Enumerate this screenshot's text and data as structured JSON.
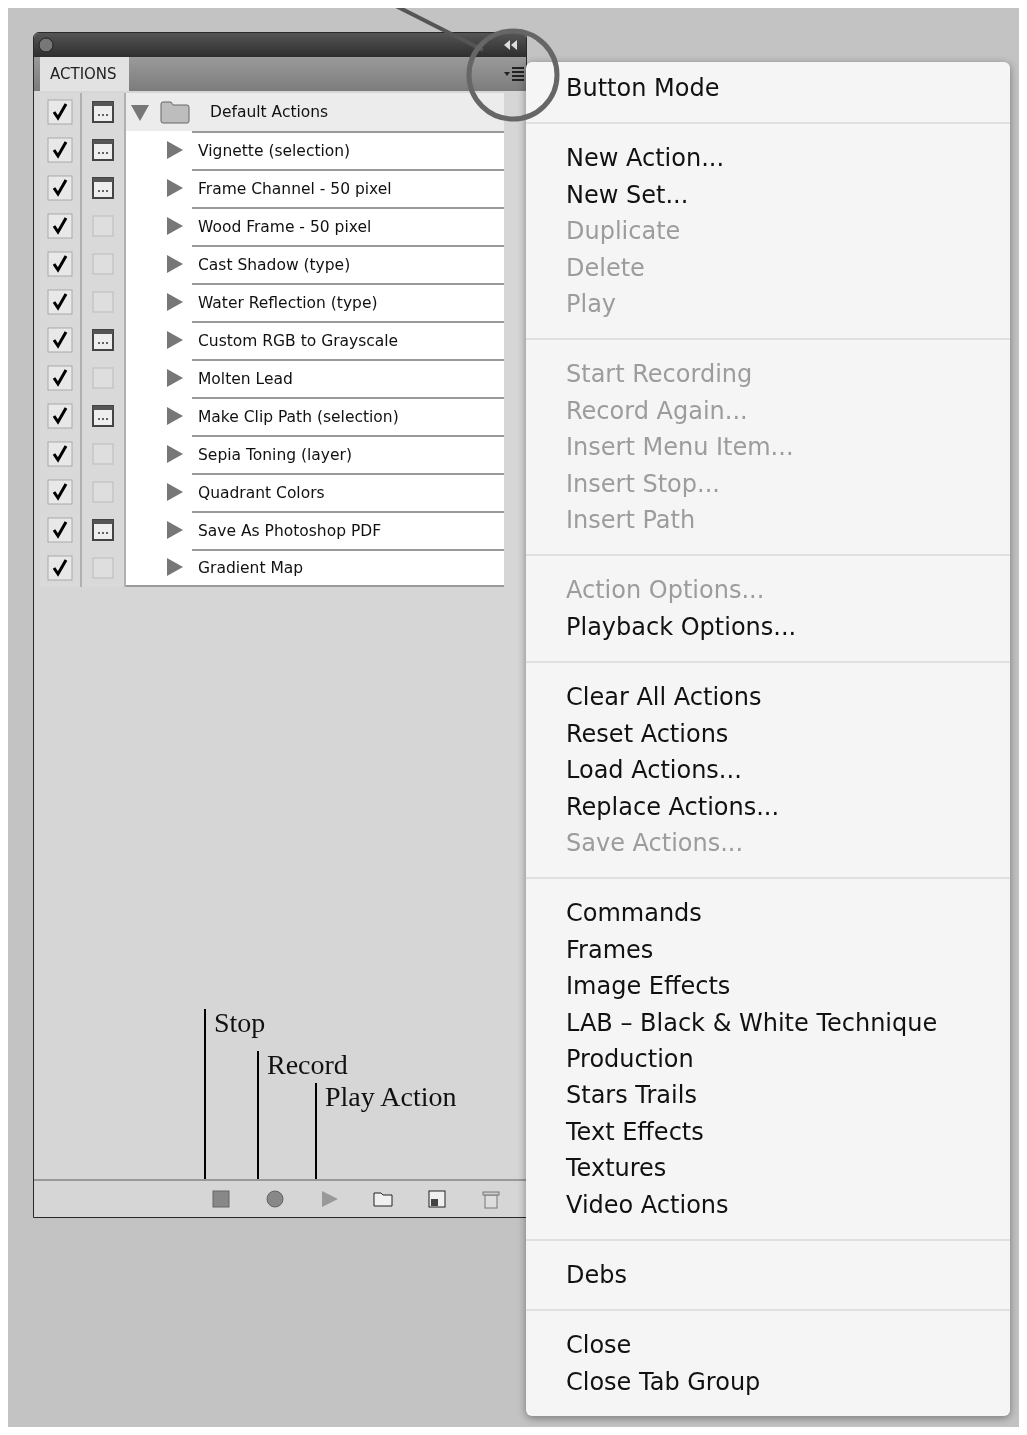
{
  "panel": {
    "tab": "ACTIONS",
    "sets": [
      {
        "name": "Default Actions",
        "expanded": true,
        "enabled": true,
        "dialog": true,
        "actions": [
          {
            "name": "Vignette (selection)",
            "expanded": false,
            "enabled": true,
            "dialog": true
          },
          {
            "name": "Frame Channel - 50 pixel",
            "expanded": false,
            "enabled": true,
            "dialog": true
          },
          {
            "name": "Wood Frame - 50 pixel",
            "expanded": false,
            "enabled": true,
            "dialog": false
          },
          {
            "name": "Cast Shadow (type)",
            "expanded": false,
            "enabled": true,
            "dialog": false
          },
          {
            "name": "Water Reflection (type)",
            "expanded": false,
            "enabled": true,
            "dialog": false
          },
          {
            "name": "Custom RGB to Grayscale",
            "expanded": false,
            "enabled": true,
            "dialog": true
          },
          {
            "name": "Molten Lead",
            "expanded": false,
            "enabled": true,
            "dialog": false
          },
          {
            "name": "Make Clip Path (selection)",
            "expanded": false,
            "enabled": true,
            "dialog": true
          },
          {
            "name": "Sepia Toning (layer)",
            "expanded": false,
            "enabled": true,
            "dialog": false
          },
          {
            "name": "Quadrant Colors",
            "expanded": false,
            "enabled": true,
            "dialog": false
          },
          {
            "name": "Save As Photoshop PDF",
            "expanded": false,
            "enabled": true,
            "dialog": true
          },
          {
            "name": "Gradient Map",
            "expanded": false,
            "enabled": true,
            "dialog": false
          }
        ]
      }
    ]
  },
  "annotations": [
    {
      "label": "Stop"
    },
    {
      "label": "Record"
    },
    {
      "label": "Play Action"
    }
  ],
  "menu": {
    "sections": [
      {
        "items": [
          {
            "label": "Button Mode",
            "disabled": false
          }
        ]
      },
      {
        "items": [
          {
            "label": "New Action...",
            "disabled": false
          },
          {
            "label": "New Set...",
            "disabled": false
          },
          {
            "label": "Duplicate",
            "disabled": true
          },
          {
            "label": "Delete",
            "disabled": true
          },
          {
            "label": "Play",
            "disabled": true
          }
        ]
      },
      {
        "items": [
          {
            "label": "Start Recording",
            "disabled": true
          },
          {
            "label": "Record Again...",
            "disabled": true
          },
          {
            "label": "Insert Menu Item...",
            "disabled": true
          },
          {
            "label": "Insert Stop...",
            "disabled": true
          },
          {
            "label": "Insert Path",
            "disabled": true
          }
        ]
      },
      {
        "items": [
          {
            "label": "Action Options...",
            "disabled": true
          },
          {
            "label": "Playback Options...",
            "disabled": false
          }
        ]
      },
      {
        "items": [
          {
            "label": "Clear All Actions",
            "disabled": false
          },
          {
            "label": "Reset Actions",
            "disabled": false
          },
          {
            "label": "Load Actions...",
            "disabled": false
          },
          {
            "label": "Replace Actions...",
            "disabled": false
          },
          {
            "label": "Save Actions...",
            "disabled": true
          }
        ]
      },
      {
        "items": [
          {
            "label": "Commands",
            "disabled": false
          },
          {
            "label": "Frames",
            "disabled": false
          },
          {
            "label": "Image Effects",
            "disabled": false
          },
          {
            "label": "LAB – Black & White Technique",
            "disabled": false
          },
          {
            "label": "Production",
            "disabled": false
          },
          {
            "label": "Stars Trails",
            "disabled": false
          },
          {
            "label": "Text Effects",
            "disabled": false
          },
          {
            "label": "Textures",
            "disabled": false
          },
          {
            "label": "Video Actions",
            "disabled": false
          }
        ]
      },
      {
        "items": [
          {
            "label": "Debs",
            "disabled": false
          }
        ]
      },
      {
        "items": [
          {
            "label": "Close",
            "disabled": false
          },
          {
            "label": "Close Tab Group",
            "disabled": false
          }
        ]
      }
    ]
  }
}
